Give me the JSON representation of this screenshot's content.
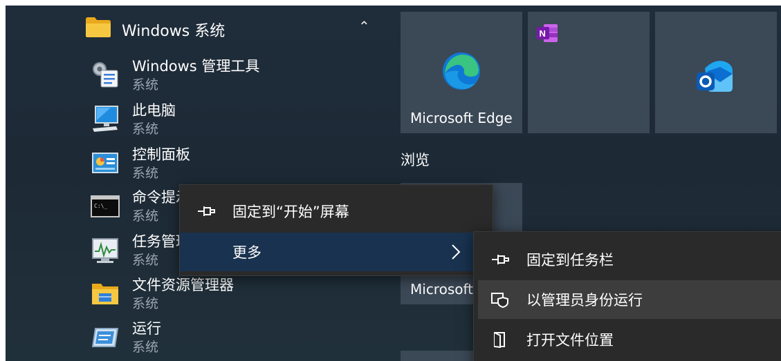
{
  "group": {
    "title": "Windows 系统",
    "icon": "folder-icon",
    "collapse_icon": "chevron-up-icon"
  },
  "apps": [
    {
      "name": "Windows 管理工具",
      "sub": "系统",
      "icon": "admin-tools-icon"
    },
    {
      "name": "此电脑",
      "sub": "系统",
      "icon": "this-pc-icon"
    },
    {
      "name": "控制面板",
      "sub": "系统",
      "icon": "control-panel-icon"
    },
    {
      "name": "命令提示符",
      "sub": "系统",
      "icon": "command-prompt-icon"
    },
    {
      "name": "任务管理器",
      "sub": "系统",
      "icon": "task-manager-icon"
    },
    {
      "name": "文件资源管理器",
      "sub": "系统",
      "icon": "file-explorer-icon"
    },
    {
      "name": "运行",
      "sub": "系统",
      "icon": "run-icon"
    }
  ],
  "tiles": {
    "edge_label": "Microsoft Edge",
    "section_label": "浏览",
    "partial_label": "Microsoft"
  },
  "context_menu": {
    "pin_start": "固定到“开始”屏幕",
    "more": "更多"
  },
  "submenu": {
    "pin_taskbar": "固定到任务栏",
    "run_as_admin": "以管理员身份运行",
    "open_location": "打开文件位置"
  },
  "colors": {
    "background": "#1f2c3a",
    "tile": "#3b4856",
    "menu": "#2a2a2a",
    "menu_highlight": "#19324f",
    "submenu_hover": "#3d3d3d",
    "subtext": "#9aa6b2"
  }
}
